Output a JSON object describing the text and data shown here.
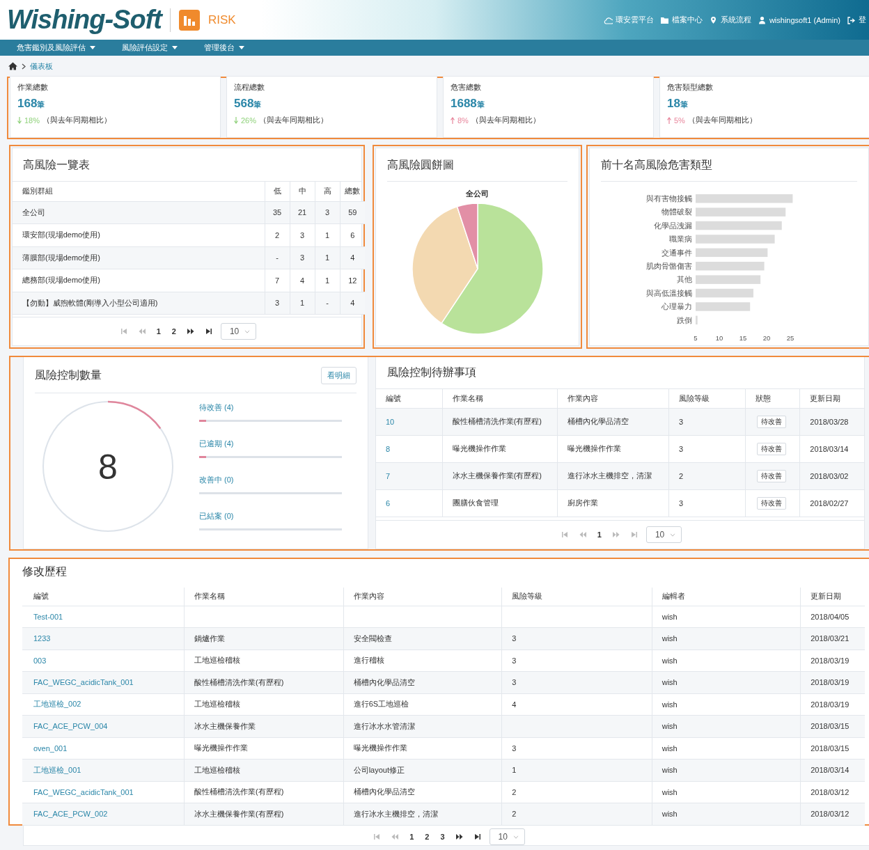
{
  "header": {
    "logo": "Wishing-Soft",
    "app_name": "RISK",
    "links": [
      {
        "kind": "cloud",
        "label": "環安雲平台"
      },
      {
        "kind": "folder",
        "label": "檔案中心"
      },
      {
        "kind": "pin",
        "label": "系統流程"
      },
      {
        "kind": "user",
        "label": "wishingsoft1 (Admin)"
      },
      {
        "kind": "logout",
        "label": "登"
      }
    ]
  },
  "nav": [
    "危害鑑別及風險評估",
    "風險評估設定",
    "管理後台"
  ],
  "breadcrumb": [
    "儀表板"
  ],
  "stats": [
    {
      "label": "作業總數",
      "value": "168",
      "unit": "筆",
      "kind": "down",
      "change": "18%",
      "note": "（與去年同期相比）"
    },
    {
      "label": "流程總數",
      "value": "568",
      "unit": "筆",
      "kind": "down",
      "change": "26%",
      "note": "（與去年同期相比）"
    },
    {
      "label": "危害總數",
      "value": "1688",
      "unit": "筆",
      "kind": "up",
      "change": "8%",
      "note": "（與去年同期相比）"
    },
    {
      "label": "危害類型總數",
      "value": "18",
      "unit": "筆",
      "kind": "up",
      "change": "5%",
      "note": "（與去年同期相比）"
    }
  ],
  "high_risk_table": {
    "title": "高風險一覽表",
    "columns": [
      {
        "label": "鑑別群組",
        "kind": "text"
      },
      {
        "label": "低",
        "kind": "num"
      },
      {
        "label": "中",
        "kind": "num"
      },
      {
        "label": "高",
        "kind": "num"
      },
      {
        "label": "總數",
        "kind": "num"
      }
    ],
    "rows": [
      [
        "全公司",
        "35",
        "21",
        "3",
        "59"
      ],
      [
        "環安部(現場demo使用)",
        "2",
        "3",
        "1",
        "6"
      ],
      [
        "薄膜部(現場demo使用)",
        "-",
        "3",
        "1",
        "4"
      ],
      [
        "總務部(現場demo使用)",
        "7",
        "4",
        "1",
        "12"
      ],
      [
        "【勿動】威煦軟體(剛導入小型公司適用)",
        "3",
        "1",
        "-",
        "4"
      ]
    ],
    "pager": {
      "pages": [
        "1",
        "2"
      ],
      "page_size": "10",
      "back_disabled": true,
      "forward_disabled": false
    }
  },
  "pie": {
    "title": "高風險圓餅圖",
    "subtitle": "全公司"
  },
  "top_hazards": {
    "title": "前十名高風險危害類型",
    "chart_data": {
      "type": "bar",
      "orientation": "horizontal",
      "categories": [
        "與有害物接觸",
        "物體破裂",
        "化學品洩漏",
        "職業病",
        "交通事件",
        "肌肉骨骼傷害",
        "其他",
        "與高低溫接觸",
        "心理暴力",
        "跌倒"
      ],
      "values": [
        25.5,
        24,
        23.2,
        21.7,
        20.2,
        19.5,
        18.7,
        17.2,
        16.5,
        5.4
      ],
      "xlim": [
        5,
        25.5
      ],
      "xticks": [
        5,
        10,
        15,
        20,
        25
      ]
    }
  },
  "control_count": {
    "title": "風險控制數量",
    "button": "看明細",
    "total": "8",
    "level": 0.15,
    "statuses": [
      {
        "label": "待改善 (4)",
        "level": 0.05
      },
      {
        "label": "已逾期 (4)",
        "level": 0.05
      },
      {
        "label": "改善中 (0)",
        "level": 0
      },
      {
        "label": "已結案 (0)",
        "level": 0
      }
    ]
  },
  "todo": {
    "title": "風險控制待辦事項",
    "columns": [
      {
        "label": "編號",
        "kind": "link"
      },
      {
        "label": "作業名稱",
        "kind": "text"
      },
      {
        "label": "作業內容",
        "kind": "text"
      },
      {
        "label": "風險等級",
        "kind": "text"
      },
      {
        "label": "狀態",
        "kind": "badge"
      },
      {
        "label": "更新日期",
        "kind": "text"
      }
    ],
    "rows": [
      [
        "10",
        "酸性桶槽清洗作業(有歷程)",
        "桶槽內化學品清空",
        "3",
        "待改善",
        "2018/03/28"
      ],
      [
        "8",
        "曝光機操作作業",
        "曝光機操作作業",
        "3",
        "待改善",
        "2018/03/14"
      ],
      [
        "7",
        "冰水主機保養作業(有歷程)",
        "進行冰水主機排空，清潔",
        "2",
        "待改善",
        "2018/03/02"
      ],
      [
        "6",
        "團膳伙食管理",
        "廚房作業",
        "3",
        "待改善",
        "2018/02/27"
      ]
    ],
    "pager": {
      "pages": [
        "1"
      ],
      "page_size": "10",
      "back_disabled": true,
      "forward_disabled": true
    }
  },
  "history": {
    "title": "修改歷程",
    "columns": [
      {
        "label": "編號",
        "kind": "link"
      },
      {
        "label": "作業名稱",
        "kind": "text"
      },
      {
        "label": "作業內容",
        "kind": "text"
      },
      {
        "label": "風險等級",
        "kind": "text"
      },
      {
        "label": "編輯者",
        "kind": "text"
      },
      {
        "label": "更新日期",
        "kind": "text"
      }
    ],
    "rows": [
      [
        "Test-001",
        "",
        "",
        "",
        "wish",
        "2018/04/05"
      ],
      [
        "1233",
        "鍋爐作業",
        "安全閥檢查",
        "3",
        "wish",
        "2018/03/21"
      ],
      [
        "003",
        "工地巡檢稽核",
        "進行稽核",
        "3",
        "wish",
        "2018/03/19"
      ],
      [
        "FAC_WEGC_acidicTank_001",
        "酸性桶槽清洗作業(有歷程)",
        "桶槽內化學品清空",
        "3",
        "wish",
        "2018/03/19"
      ],
      [
        "工地巡檢_002",
        "工地巡檢稽核",
        "進行6S工地巡檢",
        "4",
        "wish",
        "2018/03/19"
      ],
      [
        "FAC_ACE_PCW_004",
        "冰水主機保養作業",
        "進行冰水水管清潔",
        "",
        "wish",
        "2018/03/15"
      ],
      [
        "oven_001",
        "曝光機操作作業",
        "曝光機操作作業",
        "3",
        "wish",
        "2018/03/15"
      ],
      [
        "工地巡檢_001",
        "工地巡檢稽核",
        "公司layout修正",
        "1",
        "wish",
        "2018/03/14"
      ],
      [
        "FAC_WEGC_acidicTank_001",
        "酸性桶槽清洗作業(有歷程)",
        "桶槽內化學品清空",
        "2",
        "wish",
        "2018/03/12"
      ],
      [
        "FAC_ACE_PCW_002",
        "冰水主機保養作業(有歷程)",
        "進行冰水主機排空，清潔",
        "2",
        "wish",
        "2018/03/12"
      ]
    ],
    "pager": {
      "pages": [
        "1",
        "2",
        "3"
      ],
      "page_size": "10",
      "back_disabled": true,
      "forward_disabled": false
    }
  }
}
